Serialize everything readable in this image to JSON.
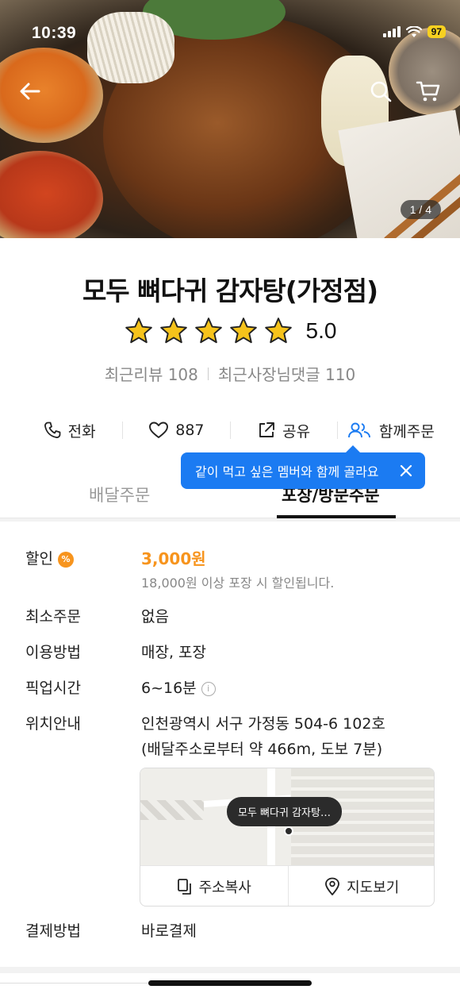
{
  "status_bar": {
    "time": "10:39",
    "battery": "97"
  },
  "hero": {
    "image_counter": "1 / 4"
  },
  "store": {
    "name": "모두 뼈다귀 감자탕(가정점)",
    "rating": "5.0",
    "stars": 5
  },
  "reviews": {
    "recent_reviews": "최근리뷰 108",
    "owner_comments": "최근사장님댓글 110"
  },
  "actions": {
    "call": "전화",
    "likes": "887",
    "share": "공유",
    "group_order": "함께주문"
  },
  "tooltip": {
    "text": "같이 먹고 싶은 멤버와 함께 골라요"
  },
  "tabs": {
    "delivery": "배달주문",
    "pickup": "포장/방문주문",
    "active": "pickup"
  },
  "info": {
    "discount_label": "할인",
    "discount_badge": "%",
    "discount_amount": "3,000원",
    "discount_note": "18,000원 이상 포장 시 할인됩니다.",
    "min_order_label": "최소주문",
    "min_order_value": "없음",
    "usage_label": "이용방법",
    "usage_value": "매장, 포장",
    "pickup_time_label": "픽업시간",
    "pickup_time_value": "6~16분",
    "location_label": "위치안내",
    "address": "인천광역시 서구 가정동 504-6 102호",
    "distance": "(배달주소로부터 약 466m, 도보 7분)",
    "payment_label": "결제방법",
    "payment_value": "바로결제"
  },
  "map": {
    "pin_label": "모두 뼈다귀 감자탕…",
    "copy_address": "주소복사",
    "view_map": "지도보기"
  },
  "colors": {
    "accent_blue": "#1b7bf2",
    "discount_orange": "#f7941d",
    "star_yellow": "#f6c31b"
  }
}
